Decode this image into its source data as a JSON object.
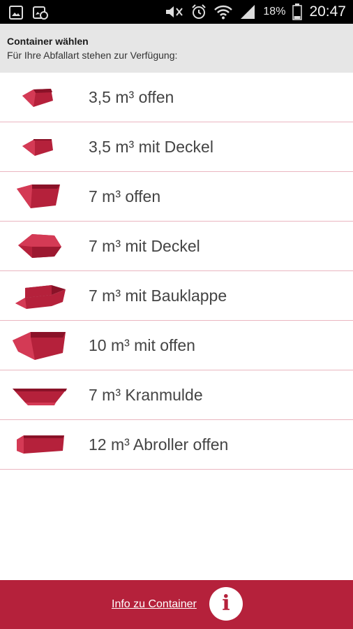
{
  "status_bar": {
    "battery_percent": "18%",
    "time": "20:47",
    "icons": [
      "image-icon",
      "gallery-icon",
      "mute-icon",
      "alarm-icon",
      "wifi-icon",
      "signal-icon",
      "battery-icon"
    ]
  },
  "header": {
    "title": "Container wählen",
    "subtitle": "Für Ihre Abfallart stehen zur Verfügung:"
  },
  "containers": [
    {
      "label": "3,5 m³ offen",
      "icon": "skip-small-open-icon"
    },
    {
      "label": "3,5 m³ mit Deckel",
      "icon": "skip-small-lid-icon"
    },
    {
      "label": "7 m³ offen",
      "icon": "skip-medium-open-icon"
    },
    {
      "label": "7 m³ mit Deckel",
      "icon": "skip-medium-lid-icon"
    },
    {
      "label": "7 m³ mit Bauklappe",
      "icon": "skip-flap-icon"
    },
    {
      "label": "10 m³ mit offen",
      "icon": "skip-large-open-icon"
    },
    {
      "label": "7 m³ Kranmulde",
      "icon": "crane-skip-icon"
    },
    {
      "label": "12 m³ Abroller offen",
      "icon": "roll-off-container-icon"
    }
  ],
  "footer": {
    "link_label": "Info zu Container",
    "info_icon": "info-icon"
  },
  "colors": {
    "accent": "#b5213b",
    "header_bg": "#e6e6e6",
    "divider": "#eab6c0"
  }
}
